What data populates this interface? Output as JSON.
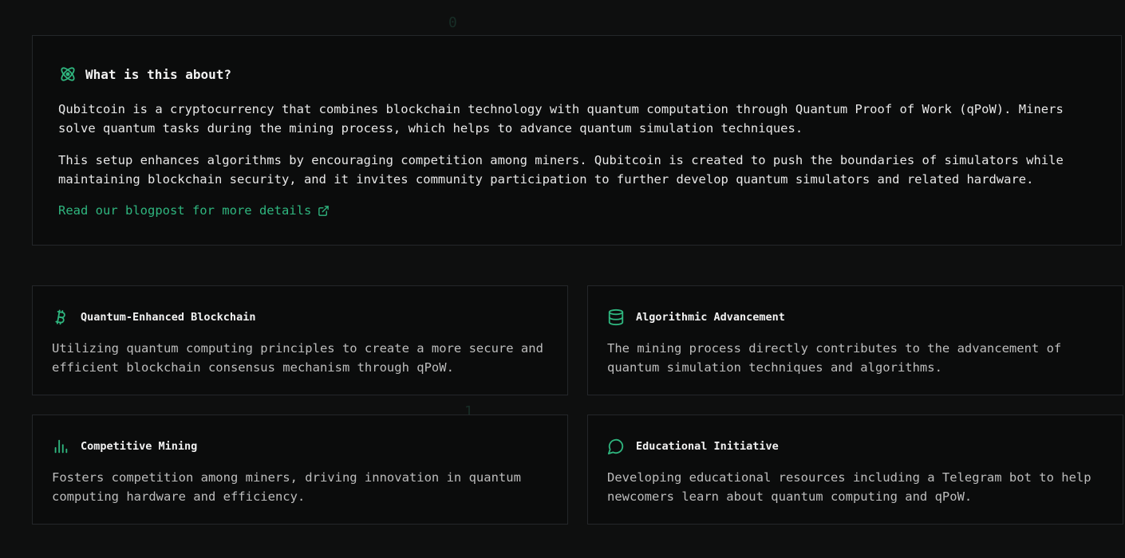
{
  "about": {
    "title": "What is this about?",
    "paragraph_1": "Qubitcoin is a cryptocurrency that combines blockchain technology with quantum computation through Quantum Proof of Work (qPoW). Miners solve quantum tasks during the mining process, which helps to advance quantum simulation techniques.",
    "paragraph_2": "This setup enhances algorithms by encouraging competition among miners. Qubitcoin is created to push the boundaries of simulators while maintaining blockchain security, and it invites community participation to further develop quantum simulators and related hardware.",
    "link_label": "Read our blogpost for more details",
    "icon": "atom-icon"
  },
  "features": [
    {
      "title": "Quantum-Enhanced Blockchain",
      "description": "Utilizing quantum computing principles to create a more secure and efficient blockchain consensus mechanism through qPoW.",
      "icon": "bitcoin-icon"
    },
    {
      "title": "Algorithmic Advancement",
      "description": "The mining process directly contributes to the advancement of quantum simulation techniques and algorithms.",
      "icon": "database-icon"
    },
    {
      "title": "Competitive Mining",
      "description": "Fosters competition among miners, driving innovation in quantum computing hardware and efficiency.",
      "icon": "bar-chart-icon"
    },
    {
      "title": "Educational Initiative",
      "description": "Developing educational resources including a Telegram bot to help newcomers learn about quantum computing and qPoW.",
      "icon": "chat-bubble-icon"
    }
  ],
  "background_glyphs": [
    "0",
    "1"
  ],
  "colors": {
    "accent": "#2fb67f",
    "background": "#0e0f0f",
    "card_background": "#0b0c0c",
    "border": "#24272a"
  }
}
